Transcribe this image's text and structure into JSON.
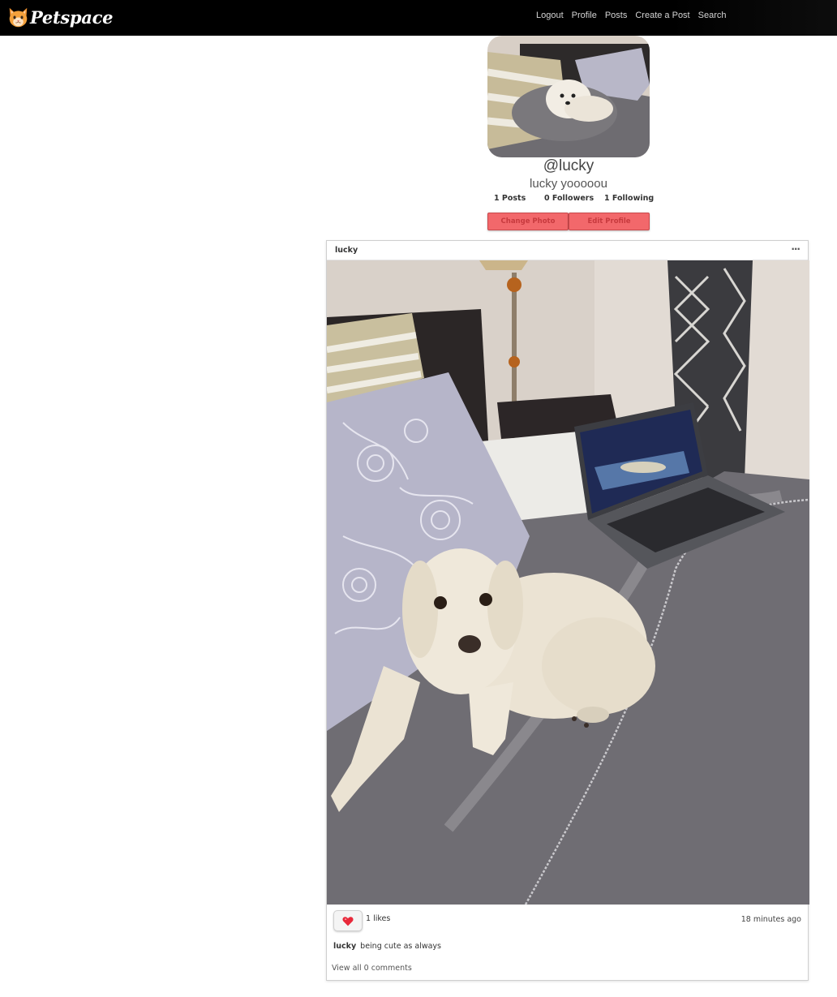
{
  "nav": {
    "brand": "Petspace",
    "links": [
      "Logout",
      "Profile",
      "Posts",
      "Create a Post",
      "Search"
    ]
  },
  "profile": {
    "handle": "@lucky",
    "display_name": "lucky yooooou",
    "stats": {
      "posts": "1 Posts",
      "followers": "0 Followers",
      "following": "1 Following"
    },
    "change_photo_label": "Change Photo",
    "edit_profile_label": "Edit Profile"
  },
  "post": {
    "username": "lucky",
    "more_label": "···",
    "likes": "1 likes",
    "time": "18 minutes ago",
    "caption_user": "lucky",
    "caption_text": "being cute as always",
    "view_comments": "View all 0 comments"
  },
  "colors": {
    "navbar": "#000000",
    "accent_button": "#f2686b",
    "like_heart": "#e8283a"
  },
  "icons": {
    "brand": "cat-face-icon",
    "more": "more-dots-icon",
    "like": "heart-icon"
  }
}
